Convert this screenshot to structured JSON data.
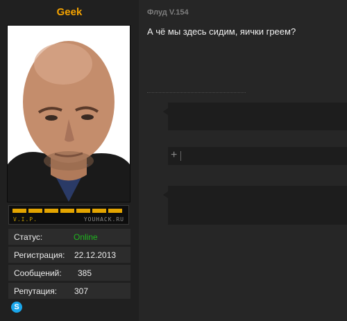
{
  "profile": {
    "username": "Geek",
    "rank_label": "V.I.P.",
    "rank_site": "YOUHACK.RU",
    "rank_level": 7,
    "stats": [
      {
        "label": "Статус:",
        "value": "Online"
      },
      {
        "label": "Регистрация:",
        "value": "22.12.2013"
      },
      {
        "label": "Сообщений:",
        "value": "385"
      },
      {
        "label": "Репутация:",
        "value": "307"
      }
    ],
    "contact_icon": "skype-icon"
  },
  "post": {
    "thread_title": "Флуд V.154",
    "text": "А чё мы здесь сидим, яички греем?"
  },
  "reply": {
    "plus_icon": "+"
  },
  "colors": {
    "username": "#f5a300",
    "online": "#1fb51f",
    "rank": "#e3a400"
  }
}
